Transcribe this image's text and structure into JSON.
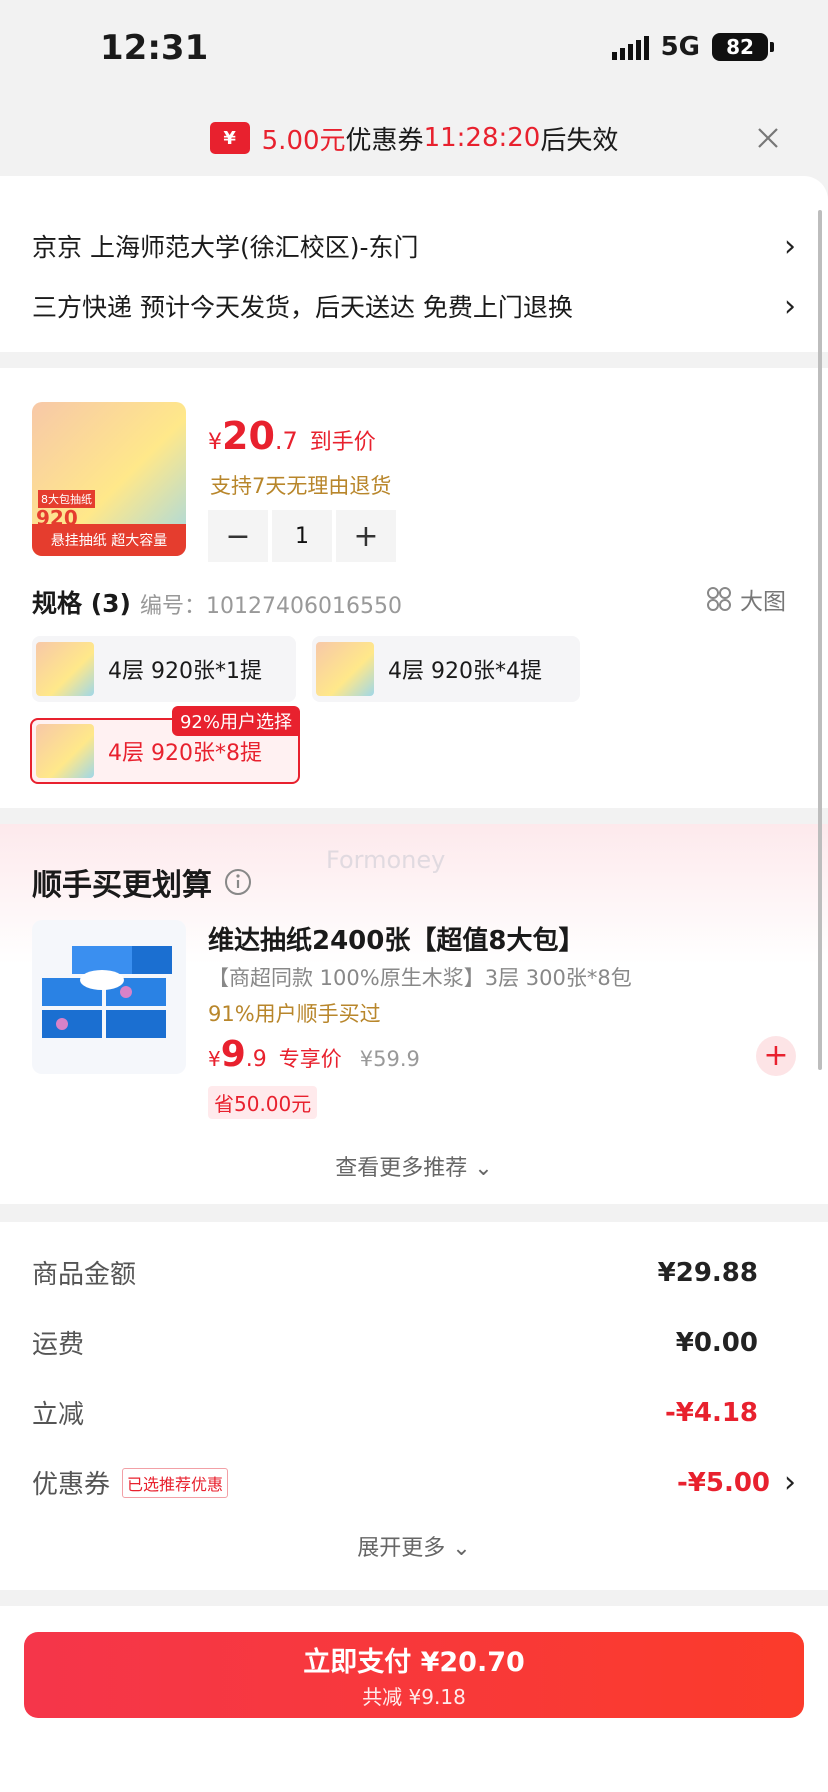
{
  "status_bar": {
    "time": "12:31",
    "network": "5G",
    "battery": "82"
  },
  "coupon_banner": {
    "icon": "¥",
    "amount": "5.00元",
    "label": "优惠券",
    "countdown": "11:28:20",
    "suffix": "后失效"
  },
  "address": {
    "location": "京京  上海师范大学(徐汇校区)-东门",
    "delivery": "三方快递 预计今天发货，后天送达 免费上门退换"
  },
  "product": {
    "thumb_label": "8大包抽纸",
    "thumb_count": "920",
    "thumb_bar": "悬挂抽纸  超大容量",
    "price_currency": "¥",
    "price_int": "20",
    "price_dec": ".7",
    "price_label": "到手价",
    "return_note": "支持7天无理由退货",
    "quantity": "1",
    "spec_title": "规格 (3)",
    "spec_code": "编号：10127406016550",
    "big_image": "大图",
    "options": [
      {
        "label": "4层 920张*1提"
      },
      {
        "label": "4层 920张*4提"
      },
      {
        "label": "4层 920张*8提",
        "badge": "92%用户选择"
      }
    ]
  },
  "recommend": {
    "title": "顺手买更划算",
    "watermark": "Formoney",
    "name": "维达抽纸2400张【超值8大包】",
    "sub": "【商超同款 100%原生木浆】3层 300张*8包",
    "buyers": "91%用户顺手买过",
    "price_currency": "¥",
    "price_int": "9",
    "price_dec": ".9",
    "price_label": "专享价",
    "orig_price": "¥59.9",
    "save": "省50.00元",
    "more": "查看更多推荐"
  },
  "summary": {
    "rows": [
      {
        "label": "商品金额",
        "value": "¥29.88"
      },
      {
        "label": "运费",
        "value": "¥0.00"
      },
      {
        "label": "立减",
        "value": "-¥4.18"
      },
      {
        "label": "优惠券",
        "tag": "已选推荐优惠",
        "value": "-¥5.00"
      }
    ],
    "expand": "展开更多"
  },
  "pay": {
    "label": "立即支付 ¥20.70",
    "sub": "共减 ¥9.18"
  }
}
